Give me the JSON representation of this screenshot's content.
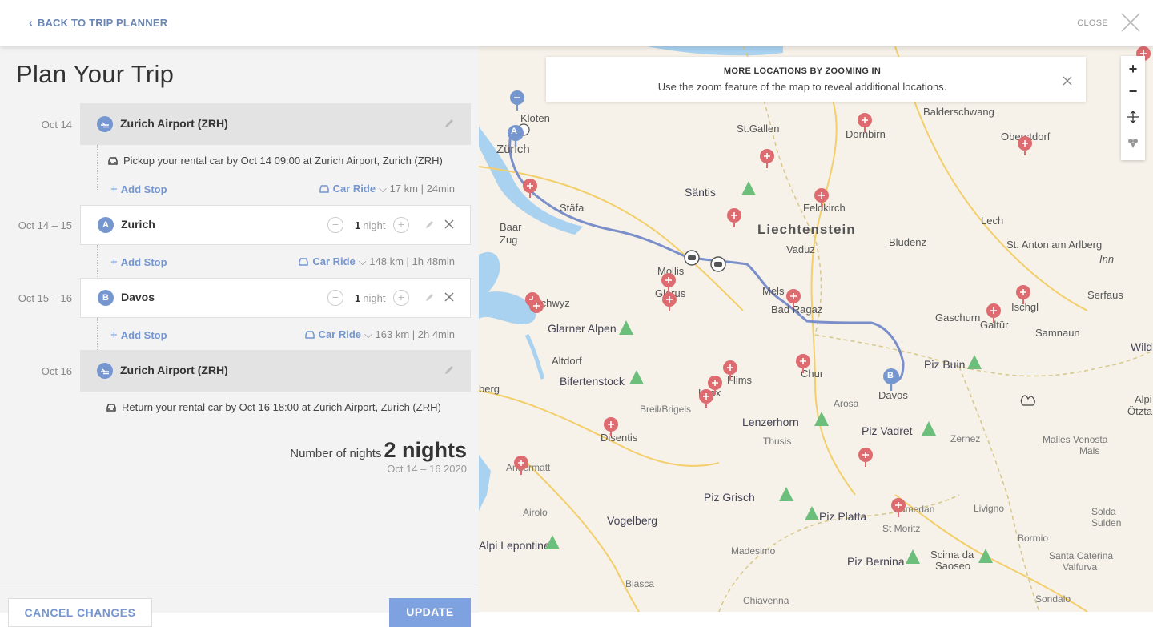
{
  "topbar": {
    "back_label": "BACK TO TRIP PLANNER",
    "close_label": "CLOSE"
  },
  "planner": {
    "title": "Plan Your Trip",
    "start": {
      "date": "Oct 14",
      "name": "Zurich Airport (ZRH)",
      "note": "Pickup your rental car by Oct 14 09:00 at Zurich Airport, Zurich (ZRH)"
    },
    "legs": [
      {
        "add_label": "Add Stop",
        "mode": "Car Ride",
        "meta": "17 km | 24min"
      },
      {
        "add_label": "Add Stop",
        "mode": "Car Ride",
        "meta": "148 km | 1h 48min"
      },
      {
        "add_label": "Add Stop",
        "mode": "Car Ride",
        "meta": "163 km | 2h 4min"
      }
    ],
    "stops": [
      {
        "date": "Oct 14 – 15",
        "letter": "A",
        "name": "Zurich",
        "nights_count": "1",
        "nights_unit": "night"
      },
      {
        "date": "Oct 15 – 16",
        "letter": "B",
        "name": "Davos",
        "nights_count": "1",
        "nights_unit": "night"
      }
    ],
    "end": {
      "date": "Oct 16",
      "name": "Zurich Airport (ZRH)",
      "note": "Return your rental car by Oct 16 18:00 at Zurich Airport, Zurich (ZRH)"
    },
    "summary": {
      "label": "Number of nights",
      "value": "2 nights",
      "range": "Oct 14 – 16 2020"
    },
    "buttons": {
      "cancel": "CANCEL CHANGES",
      "update": "UPDATE"
    }
  },
  "map": {
    "banner": {
      "title": "MORE LOCATIONS BY ZOOMING IN",
      "text": "Use the zoom feature of the map to reveal additional locations."
    },
    "zoom_in": "+",
    "zoom_out": "−",
    "markers": [
      "A",
      "B"
    ],
    "labels": {
      "zurich": "Zürich",
      "kloten": "Kloten",
      "st_gallen": "St.Gallen",
      "dornbirn": "Dornbirn",
      "balderschwang": "Balderschwang",
      "oberstdorf": "Oberstdorf",
      "santis": "Säntis",
      "feldkirch": "Feldkirch",
      "staefa": "Stäfa",
      "baar": "Baar",
      "zug": "Zug",
      "liechtenstein": "Liechtenstein",
      "lech": "Lech",
      "bludenz": "Bludenz",
      "vaduz": "Vaduz",
      "st_anton": "St. Anton am Arlberg",
      "inn": "Inn",
      "mollis": "Mollis",
      "glarus": "Glarus",
      "schwyz": "Schwyz",
      "mels": "Mels",
      "bad_ragaz": "Bad Ragaz",
      "serfaus": "Serfaus",
      "ischgl": "Ischgl",
      "gaschurn": "Gaschurn",
      "galtur": "Galtür",
      "samnaun": "Samnaun",
      "glarner_alpen": "Glarner Alpen",
      "wild": "Wild",
      "altdorf": "Altdorf",
      "piz_buin": "Piz Buin",
      "bifertenstock": "Bifertenstock",
      "flims": "Flims",
      "laax": "Laax",
      "chur": "Chur",
      "davos": "Davos",
      "berg": "berg",
      "breil": "Breil/Brigels",
      "arosa": "Arosa",
      "alpi": "Alpi",
      "otztal": "Ötztal",
      "lenzerhorn": "Lenzerhorn",
      "piz_vadret": "Piz Vadret",
      "disentis": "Disentis",
      "thusis": "Thusis",
      "zernez": "Zernez",
      "malles": "Malles Venosta",
      "mals": "Mals",
      "andermatt": "Andermatt",
      "piz_grisch": "Piz Grisch",
      "airolo": "Airolo",
      "samedan": "Samedan",
      "livigno": "Livigno",
      "solda": "Solda",
      "sulden": "Sulden",
      "vogelberg": "Vogelberg",
      "piz_platta": "Piz Platta",
      "st_moritz": "St Moritz",
      "bormio": "Bormio",
      "lepontine": "Alpi Lepontine",
      "madesimo": "Madesimo",
      "piz_bernina": "Piz Bernina",
      "scima": "Scima da",
      "saoseo": "Saoseo",
      "santa_caterina": "Santa Caterina",
      "valfurva": "Valfurva",
      "biasca": "Biasca",
      "chiavenna": "Chiavenna",
      "sondalo": "Sondalo"
    }
  }
}
